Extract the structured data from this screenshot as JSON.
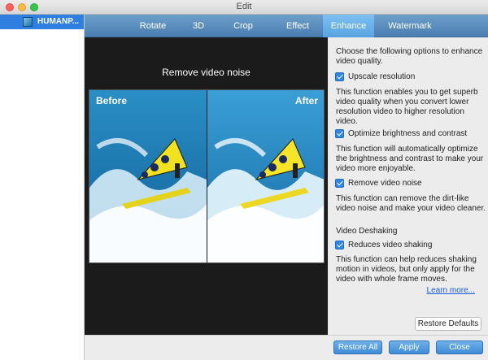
{
  "window": {
    "title": "Edit"
  },
  "sidebar": {
    "file_name": "HUMANP..."
  },
  "tabs": [
    {
      "label": "Rotate",
      "active": false
    },
    {
      "label": "3D",
      "active": false
    },
    {
      "label": "Crop",
      "active": false
    },
    {
      "label": "Effect",
      "active": false
    },
    {
      "label": "Enhance",
      "active": true
    },
    {
      "label": "Watermark",
      "active": false
    }
  ],
  "preview": {
    "title": "Remove video noise",
    "before_label": "Before",
    "after_label": "After"
  },
  "options": {
    "intro": "Choose the following options to enhance video quality.",
    "upscale": {
      "label": "Upscale resolution",
      "checked": true,
      "desc": "This function enables you to get superb video quality when you convert lower resolution video to higher resolution video."
    },
    "brightness": {
      "label": "Optimize brightness and contrast",
      "checked": true,
      "desc": "This function will automatically optimize the brightness and contrast to make your video more enjoyable."
    },
    "noise": {
      "label": "Remove video noise",
      "checked": true,
      "desc": "This function can remove the dirt-like video noise and make your video cleaner."
    },
    "deshake_section": "Video Deshaking",
    "deshake": {
      "label": "Reduces video shaking",
      "checked": true,
      "desc": "This function can help reduces shaking motion in videos, but only apply for the video with whole frame moves."
    },
    "learn_more": "Learn more...",
    "restore_defaults": "Restore Defaults"
  },
  "buttons": {
    "restore_all": "Restore All",
    "apply": "Apply",
    "close": "Close"
  },
  "colors": {
    "accent": "#2f86e6",
    "tab_bar": "#4a7db0",
    "active_tab": "#6bb0e8"
  }
}
